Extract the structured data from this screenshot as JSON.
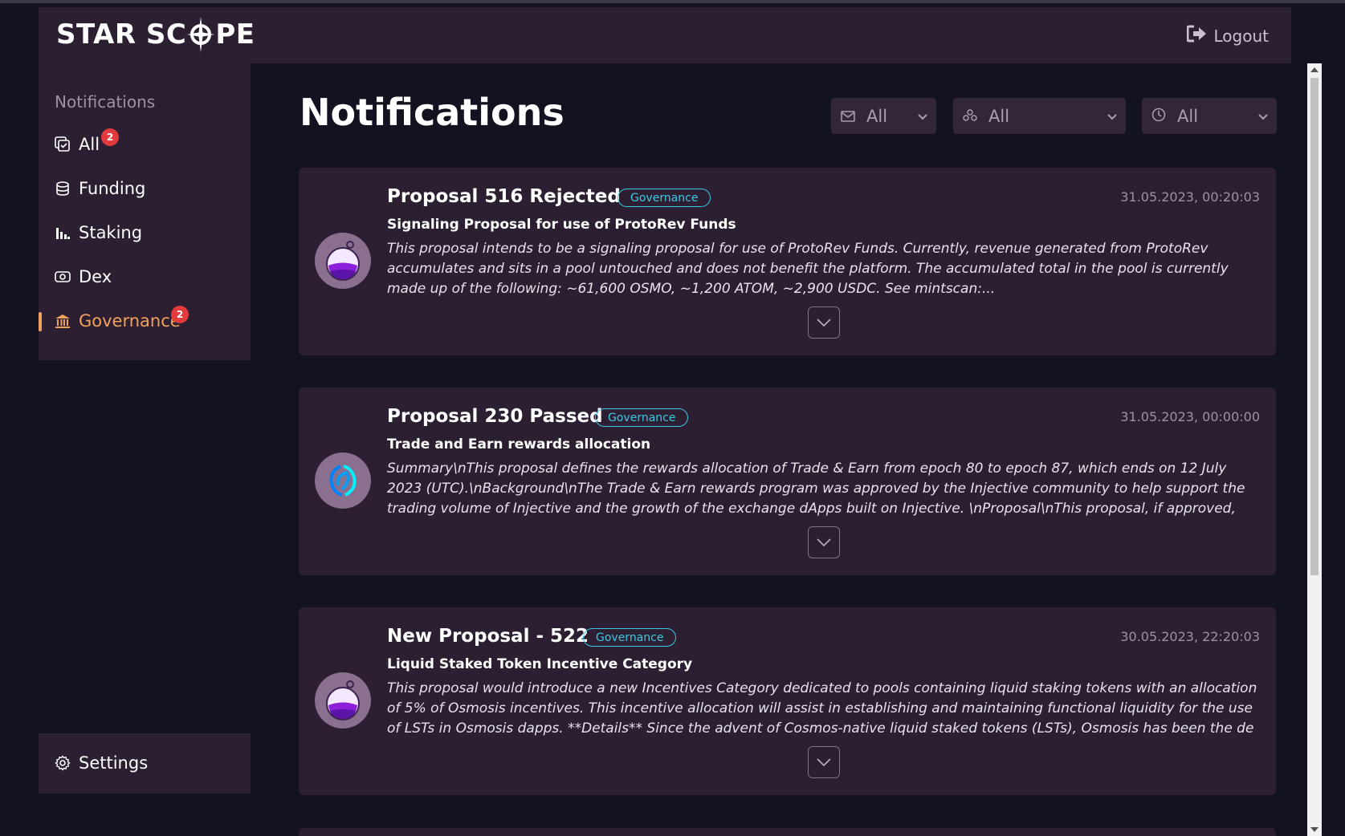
{
  "header": {
    "logo_part1": "STAR SC",
    "logo_part2": "PE",
    "logout_label": "Logout"
  },
  "sidebar": {
    "title": "Notifications",
    "items": [
      {
        "label": "All",
        "badge": "2",
        "icon": "inbox-check-icon"
      },
      {
        "label": "Funding",
        "badge": "",
        "icon": "coins-stack-icon"
      },
      {
        "label": "Staking",
        "badge": "",
        "icon": "bar-chart-icon"
      },
      {
        "label": "Dex",
        "badge": "",
        "icon": "exchange-icon"
      },
      {
        "label": "Governance",
        "badge": "2",
        "icon": "bank-icon",
        "active": true
      }
    ],
    "settings_label": "Settings"
  },
  "main": {
    "title": "Notifications",
    "filters": [
      {
        "value": "All",
        "icon": "mail-icon"
      },
      {
        "value": "All",
        "icon": "chain-icon"
      },
      {
        "value": "All",
        "icon": "clock-icon"
      }
    ],
    "cards": [
      {
        "title": "Proposal 516 Rejected",
        "tag": "Governance",
        "timestamp": "31.05.2023, 00:20:03",
        "subtitle": "Signaling Proposal for use of ProtoRev Funds",
        "description": "This proposal intends to be a signaling proposal for use of ProtoRev Funds. Currently, revenue generated from ProtoRev accumulates and sits in a pool untouched and does not benefit the platform. The accumulated total in the pool is currently made up of the following: ~61,600 OSMO, ~1,200 ATOM, ~2,900 USDC. See mintscan:...",
        "avatar": "osmosis-logo"
      },
      {
        "title": "Proposal 230 Passed",
        "tag": "Governance",
        "timestamp": "31.05.2023, 00:00:00",
        "subtitle": "Trade and Earn rewards allocation",
        "description": "Summary\\nThis proposal defines the rewards allocation of Trade & Earn from epoch 80 to epoch 87, which ends on 12 July 2023 (UTC).\\nBackground\\nThe Trade & Earn rewards program was approved by the Injective community to help support the trading volume of Injective and the growth of the exchange dApps built on Injective. \\nProposal\\nThis proposal, if approved, will extend Trade & Earn rewards ...",
        "avatar": "injective-logo"
      },
      {
        "title": "New Proposal - 522",
        "tag": "Governance",
        "timestamp": "30.05.2023, 22:20:03",
        "subtitle": "Liquid Staked Token Incentive Category",
        "description": "This proposal would introduce a new Incentives Category dedicated to pools containing liquid staking tokens with an allocation of 5% of Osmosis incentives. This incentive allocation will assist in establishing and maintaining functional liquidity for the use of LSTs in Osmosis dapps. **Details** Since the advent of Cosmos-native liquid staked tokens (LSTs), Osmosis has been the de facto hub of LST activity, despite...",
        "avatar": "osmosis-logo"
      }
    ]
  },
  "colors": {
    "background": "#121220",
    "panel": "#2c1f31",
    "accent": "#f0a25c",
    "tag": "#3dc8e5",
    "badge": "#e33a3e"
  }
}
